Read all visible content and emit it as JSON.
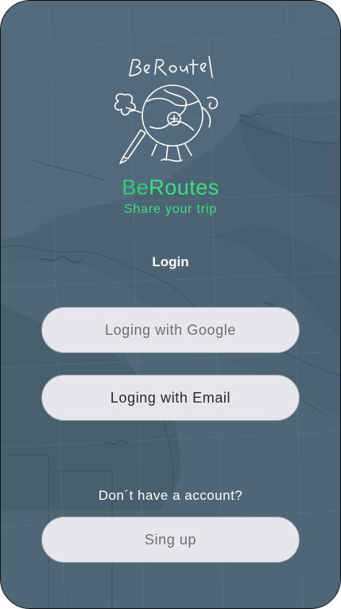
{
  "brand": {
    "title_part1": "Be",
    "title_part2": "Routes",
    "tagline": "Share your trip",
    "logo_text": "BeRoute",
    "accent_color": "#38e07e"
  },
  "login": {
    "heading": "Login",
    "google_button": "Loging with Google",
    "email_button": "Loging with Email"
  },
  "signup": {
    "prompt": "Don´t have a account?",
    "button": "Sing up"
  },
  "icons": {
    "logo": "globe-pen-logo-icon",
    "background": "world-map-background"
  }
}
